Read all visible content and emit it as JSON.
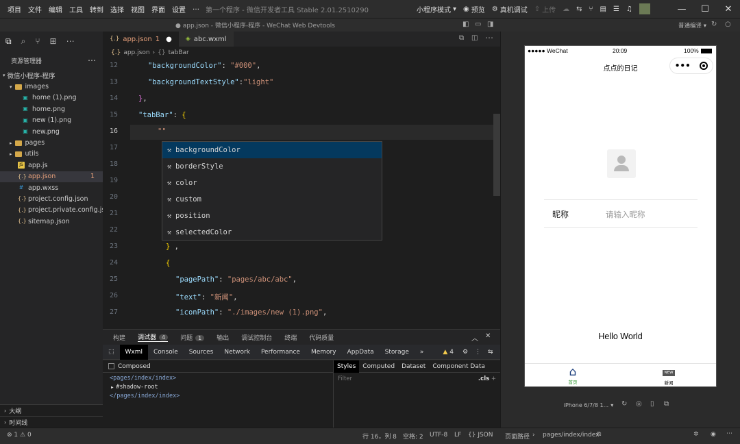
{
  "menu": [
    "项目",
    "文件",
    "编辑",
    "工具",
    "转到",
    "选择",
    "视图",
    "界面",
    "设置",
    "…"
  ],
  "window_title": "第一个程序 - 微信开发者工具 Stable 2.01.2510290",
  "toolbar": {
    "mode": "小程序模式",
    "preview": "预览",
    "device_debug": "真机调试",
    "upload": "上传"
  },
  "editor_title": "● app.json - 微信小程序-程序 - WeChat Web Devtools",
  "compile": "普通编译",
  "explorer": {
    "title": "资源管理器",
    "project": "微信小程序-程序",
    "items": [
      {
        "label": "images",
        "type": "folder",
        "depth": 1,
        "open": true
      },
      {
        "label": "home (1).png",
        "type": "png",
        "depth": 2
      },
      {
        "label": "home.png",
        "type": "png",
        "depth": 2
      },
      {
        "label": "new (1).png",
        "type": "png",
        "depth": 2
      },
      {
        "label": "new.png",
        "type": "png",
        "depth": 2
      },
      {
        "label": "pages",
        "type": "folder",
        "depth": 1,
        "open": false
      },
      {
        "label": "utils",
        "type": "folder",
        "depth": 1,
        "open": false
      },
      {
        "label": "app.js",
        "type": "js",
        "depth": 1
      },
      {
        "label": "app.json",
        "type": "json",
        "depth": 1,
        "active": true,
        "badge": "1"
      },
      {
        "label": "app.wxss",
        "type": "wxss",
        "depth": 1
      },
      {
        "label": "project.config.json",
        "type": "json",
        "depth": 1
      },
      {
        "label": "project.private.config.js...",
        "type": "json",
        "depth": 1
      },
      {
        "label": "sitemap.json",
        "type": "json",
        "depth": 1
      }
    ],
    "outline": "大纲",
    "timeline": "时间线"
  },
  "tabs": [
    {
      "label": "app.json",
      "suffix": "1",
      "modified": true,
      "active": true
    },
    {
      "label": "abc.wxml",
      "active": false
    }
  ],
  "breadcrumb": {
    "file": "app.json",
    "symbol": "tabBar"
  },
  "code_lines": [
    {
      "n": "12",
      "text": "\"backgroundColor\": \"#000\","
    },
    {
      "n": "13",
      "text": "\"backgroundTextStyle\":\"light\""
    },
    {
      "n": "14",
      "text": "},"
    },
    {
      "n": "15",
      "text": "\"tabBar\": {"
    },
    {
      "n": "16",
      "text": "\"\""
    },
    {
      "n": "17",
      "text": "\""
    },
    {
      "n": "18",
      "text": ""
    },
    {
      "n": "19",
      "text": ""
    },
    {
      "n": "20",
      "text": ""
    },
    {
      "n": "21",
      "text": ""
    },
    {
      "n": "22",
      "text": "} ,"
    },
    {
      "n": "23",
      "text": "} ,"
    },
    {
      "n": "24",
      "text": "{"
    },
    {
      "n": "25",
      "text": "\"pagePath\": \"pages/abc/abc\","
    },
    {
      "n": "26",
      "text": "\"text\": \"新闻\","
    },
    {
      "n": "27",
      "text": "\"iconPath\": \"./images/new (1).png\","
    }
  ],
  "suggestions": [
    "backgroundColor",
    "borderStyle",
    "color",
    "custom",
    "position",
    "selectedColor"
  ],
  "panel_tabs": [
    {
      "label": "构建"
    },
    {
      "label": "调试器",
      "badge": "4"
    },
    {
      "label": "问题",
      "badge": "1"
    },
    {
      "label": "输出"
    },
    {
      "label": "调试控制台"
    },
    {
      "label": "终端"
    },
    {
      "label": "代码质量"
    }
  ],
  "devtools_tabs": [
    "Wxml",
    "Console",
    "Sources",
    "Network",
    "Performance",
    "Memory",
    "AppData",
    "Storage"
  ],
  "warnings": "4",
  "composed": "Composed",
  "wxml_tree": [
    "<pages/index/index>",
    "#shadow-root",
    "</pages/index/index>"
  ],
  "styles_tabs": [
    "Styles",
    "Computed",
    "Dataset",
    "Component Data"
  ],
  "filter_placeholder": "Filter",
  "cls": ".cls",
  "status": {
    "errors": "1",
    "warnings": "0",
    "position": "行 16，列 8",
    "spaces": "空格: 2",
    "encoding": "UTF-8",
    "eol": "LF",
    "language": "{} JSON",
    "page_path_label": "页面路径",
    "page_path": "pages/index/index"
  },
  "phone": {
    "carrier": "●●●●● WeChat",
    "time": "20:09",
    "battery": "100%",
    "nav_title": "点点的日记",
    "nickname_label": "昵称",
    "nickname_placeholder": "请输入昵称",
    "hello": "Hello World",
    "tab_home": "首页",
    "tab_news": "新闻",
    "new_badge": "NEW"
  },
  "device": "iPhone 6/7/8 1..."
}
